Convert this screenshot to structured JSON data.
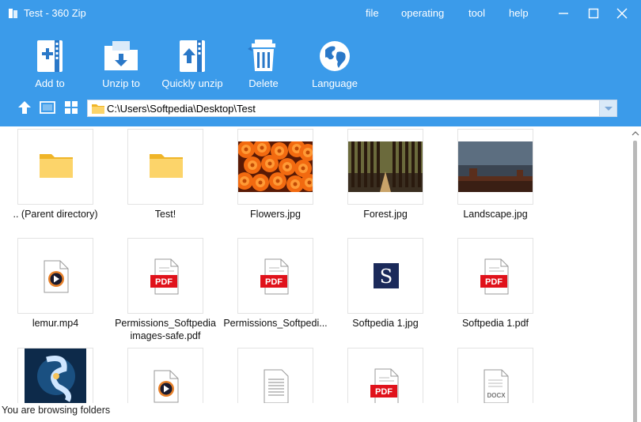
{
  "window": {
    "title": "Test - 360 Zip"
  },
  "menu": [
    {
      "label": "file"
    },
    {
      "label": "operating"
    },
    {
      "label": "tool"
    },
    {
      "label": "help"
    }
  ],
  "toolbar": [
    {
      "label": "Add to",
      "icon": "add-archive-icon"
    },
    {
      "label": "Unzip to",
      "icon": "unzip-folder-icon"
    },
    {
      "label": "Quickly unzip",
      "icon": "quick-unzip-icon"
    },
    {
      "label": "Delete",
      "icon": "trash-icon"
    },
    {
      "label": "Language",
      "icon": "globe-icon"
    }
  ],
  "address": {
    "path": "C:\\Users\\Softpedia\\Desktop\\Test"
  },
  "files": [
    {
      "name": ".. (Parent directory)",
      "type": "folder"
    },
    {
      "name": "Test!",
      "type": "folder"
    },
    {
      "name": "Flowers.jpg",
      "type": "image-flowers"
    },
    {
      "name": "Forest.jpg",
      "type": "image-forest"
    },
    {
      "name": "Landscape.jpg",
      "type": "image-landscape"
    },
    {
      "name": "lemur.mp4",
      "type": "video"
    },
    {
      "name": "Permissions_Softpedia images-safe.pdf",
      "type": "pdf"
    },
    {
      "name": "Permissions_Softpedi...",
      "type": "pdf"
    },
    {
      "name": "Softpedia 1.jpg",
      "type": "image-softpedia"
    },
    {
      "name": "Softpedia 1.pdf",
      "type": "pdf"
    },
    {
      "name": "",
      "type": "image-abstract"
    },
    {
      "name": "",
      "type": "video"
    },
    {
      "name": "",
      "type": "text"
    },
    {
      "name": "",
      "type": "pdf"
    },
    {
      "name": "",
      "type": "docx"
    }
  ],
  "icon_text": {
    "pdf": "PDF",
    "docx": "DOCX",
    "softpedia": "S"
  },
  "status": "You are browsing folders",
  "colors": {
    "header": "#3b9bea",
    "pdf_red": "#e0121b",
    "folder": "#fcd46a"
  }
}
